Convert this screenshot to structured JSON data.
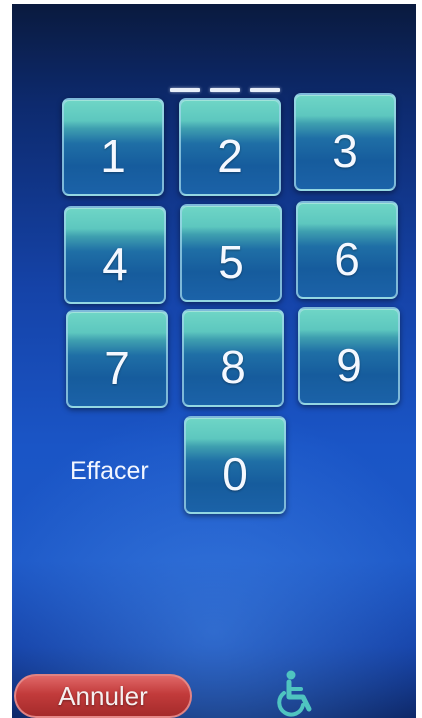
{
  "pin_display": {
    "slots": [
      "",
      "",
      ""
    ]
  },
  "keypad": {
    "keys": [
      "1",
      "2",
      "3",
      "4",
      "5",
      "6",
      "7",
      "8",
      "9",
      "0"
    ],
    "clear_label": "Effacer"
  },
  "footer": {
    "cancel_label": "Annuler",
    "accessibility_icon": "wheelchair-icon"
  },
  "colors": {
    "background_top": "#0a1a3e",
    "background_mid": "#1a55c6",
    "key_top": "#6fd6c6",
    "key_bottom": "#165c9d",
    "cancel_button": "#c23b3b",
    "accessibility_icon": "#4fc4c0"
  }
}
